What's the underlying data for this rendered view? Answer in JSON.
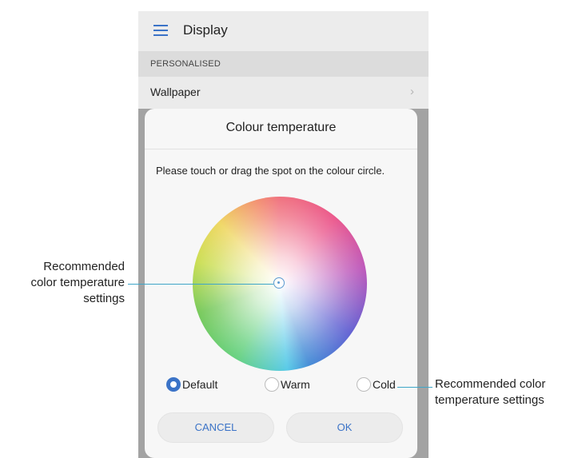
{
  "app_bar": {
    "menu_icon": "hamburger-menu-icon",
    "title": "Display"
  },
  "section": {
    "header": "PERSONALISED"
  },
  "wallpaper_row": {
    "label": "Wallpaper",
    "chevron": "›"
  },
  "dialog": {
    "title": "Colour temperature",
    "instruction": "Please touch or drag the spot on the colour circle.",
    "options": [
      {
        "label": "Default",
        "selected": true
      },
      {
        "label": "Warm",
        "selected": false
      },
      {
        "label": "Cold",
        "selected": false
      }
    ],
    "cancel_label": "CANCEL",
    "ok_label": "OK"
  },
  "callouts": {
    "left": [
      "Recommended",
      "color temperature",
      "settings"
    ],
    "right": [
      "Recommended color",
      "temperature settings"
    ]
  },
  "colors": {
    "accent": "#3b73c7",
    "leader_line": "#3fa6c8"
  }
}
